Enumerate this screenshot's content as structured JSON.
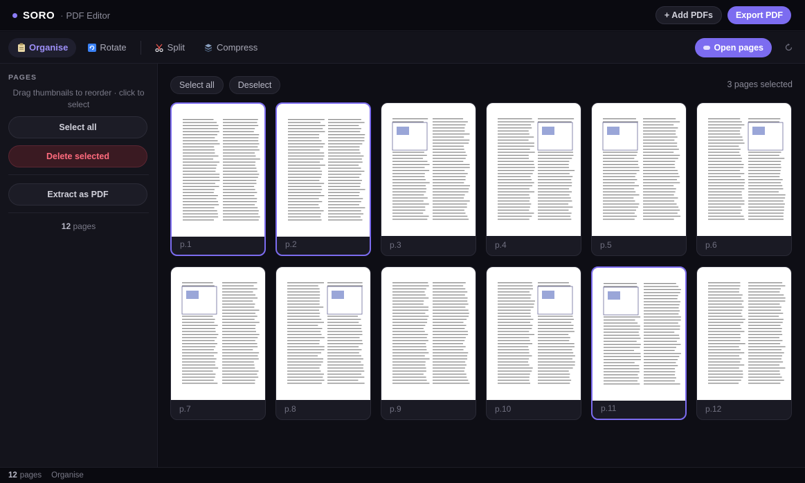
{
  "header": {
    "brand": "SORO",
    "separator": "·",
    "subtitle": "PDF Editor",
    "add_pdfs": "+ Add PDFs",
    "export_pdf": "Export PDF"
  },
  "toolbar": {
    "tools": [
      {
        "label": "Organise",
        "icon": "clipboard-icon",
        "active": true
      },
      {
        "label": "Rotate",
        "icon": "rotate-icon",
        "active": false
      },
      {
        "label": "Split",
        "icon": "scissors-icon",
        "active": false
      },
      {
        "label": "Compress",
        "icon": "compress-icon",
        "active": false
      }
    ],
    "open_pages": "Open pages",
    "reset_icon": "reset-icon"
  },
  "sidebar": {
    "title": "PAGES",
    "hint": "Drag thumbnails to reorder · click to select",
    "select_all": "Select all",
    "delete_selected": "Delete selected",
    "extract": "Extract as PDF",
    "count_num": "12",
    "count_label": "pages"
  },
  "main": {
    "select_all": "Select all",
    "deselect": "Deselect",
    "selection_info": "3 pages selected",
    "pages": [
      {
        "label": "p.1",
        "selected": true
      },
      {
        "label": "p.2",
        "selected": true
      },
      {
        "label": "p.3",
        "selected": false
      },
      {
        "label": "p.4",
        "selected": false
      },
      {
        "label": "p.5",
        "selected": false
      },
      {
        "label": "p.6",
        "selected": false
      },
      {
        "label": "p.7",
        "selected": false
      },
      {
        "label": "p.8",
        "selected": false
      },
      {
        "label": "p.9",
        "selected": false
      },
      {
        "label": "p.10",
        "selected": false
      },
      {
        "label": "p.11",
        "selected": true
      },
      {
        "label": "p.12",
        "selected": false
      }
    ]
  },
  "status": {
    "count_num": "12",
    "count_label": "pages",
    "mode": "Organise"
  },
  "colors": {
    "accent": "#7c6cf0",
    "danger": "#ff6b7d",
    "background": "#0d0d14"
  }
}
